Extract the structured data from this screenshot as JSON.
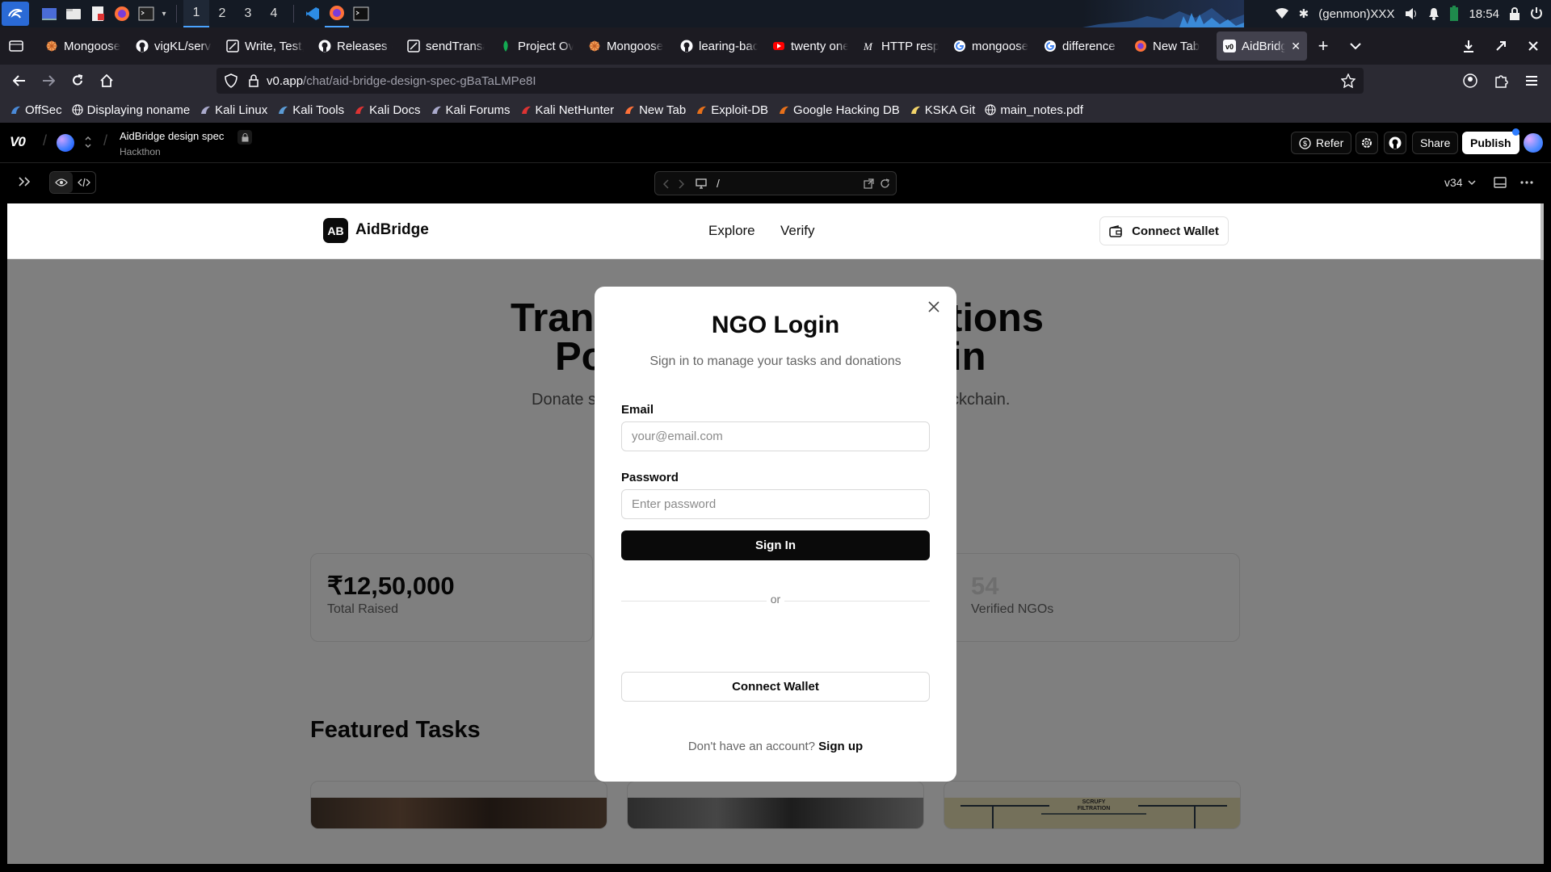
{
  "taskbar": {
    "workspaces": [
      "1",
      "2",
      "3",
      "4"
    ],
    "active_workspace": "1",
    "genmon": "(genmon)XXX",
    "clock": "18:54"
  },
  "tabs": [
    {
      "label": "Mongoose",
      "icon": "mongoose-icon"
    },
    {
      "label": "vigKL/serve",
      "icon": "github-icon"
    },
    {
      "label": "Write, Test,",
      "icon": "postman-icon"
    },
    {
      "label": "Releases · s",
      "icon": "github-icon"
    },
    {
      "label": "sendTransa",
      "icon": "docs-icon"
    },
    {
      "label": "Project Ove",
      "icon": "mongodb-leaf-icon"
    },
    {
      "label": "Mongoose",
      "icon": "mongoose-icon"
    },
    {
      "label": "learing-bac",
      "icon": "github-icon"
    },
    {
      "label": "twenty one",
      "icon": "youtube-icon"
    },
    {
      "label": "HTTP respo",
      "icon": "mdn-icon"
    },
    {
      "label": "mongoose",
      "icon": "google-icon"
    },
    {
      "label": "difference b",
      "icon": "google-icon"
    },
    {
      "label": "New Tab",
      "icon": "firefox-icon"
    },
    {
      "label": "AidBridge",
      "icon": "v0-icon",
      "active": true
    }
  ],
  "url": {
    "host": "v0.app",
    "path": "/chat/aid-bridge-design-spec-gBaTaLMPe8I"
  },
  "bookmarks": [
    "OffSec",
    "Displaying noname",
    "Kali Linux",
    "Kali Tools",
    "Kali Docs",
    "Kali Forums",
    "Kali NetHunter",
    "New Tab",
    "Exploit-DB",
    "Google Hacking DB",
    "KSKA Git",
    "main_notes.pdf"
  ],
  "v0": {
    "logo": "V0",
    "project_title": "AidBridge design spec",
    "project_subtitle": "Hackthon",
    "refer": "Refer",
    "share": "Share",
    "publish": "Publish",
    "route": "/",
    "version": "v34"
  },
  "site": {
    "logo_badge": "AB",
    "brand": "AidBridge",
    "nav": [
      "Explore",
      "Verify"
    ],
    "connect_wallet": "Connect Wallet",
    "hero_left_1": "Tran",
    "hero_right_1": "tions",
    "hero_left_2": "Po",
    "hero_right_2": "in",
    "sub_left": "Donate s",
    "sub_right": "ckchain.",
    "stats": [
      {
        "value": "₹12,50,000",
        "label": "Total Raised"
      },
      {
        "value": "54",
        "label": "Verified NGOs"
      }
    ],
    "featured_title": "Featured Tasks",
    "card3_caption": "SCRUFY FILTRATION"
  },
  "modal": {
    "title": "NGO Login",
    "subtitle": "Sign in to manage your tasks and donations",
    "email_label": "Email",
    "email_placeholder": "your@email.com",
    "password_label": "Password",
    "password_placeholder": "Enter password",
    "sign_in": "Sign In",
    "or": "or",
    "connect_wallet": "Connect Wallet",
    "signup_prompt": "Don't have an account?",
    "signup_link": "Sign up"
  }
}
